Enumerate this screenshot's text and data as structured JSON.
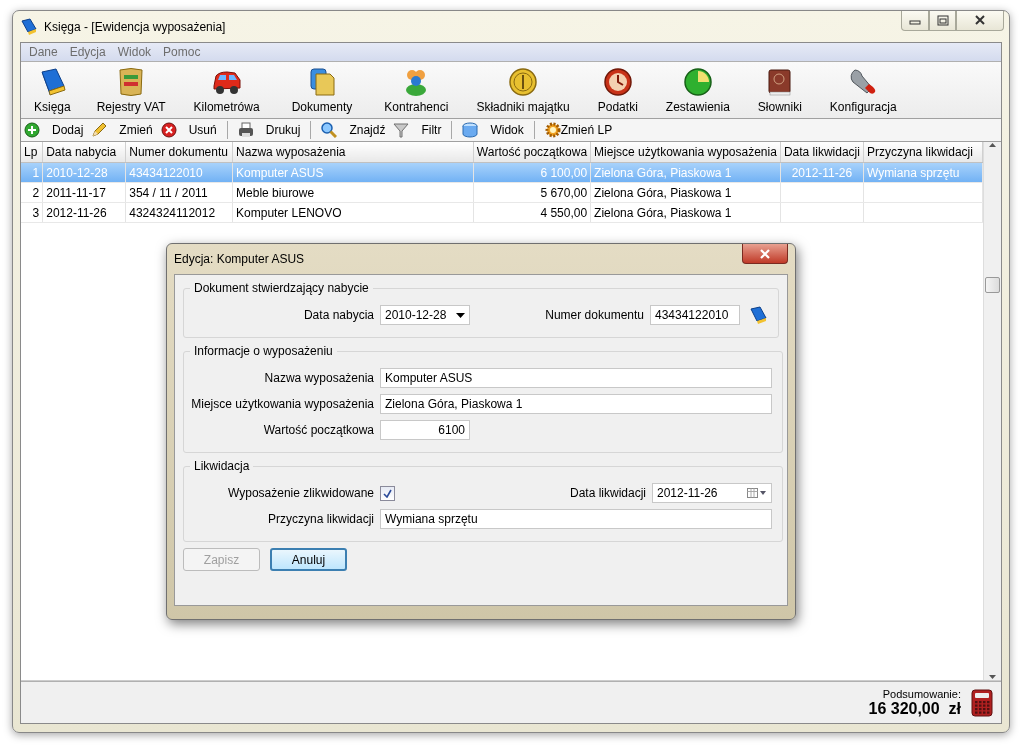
{
  "window": {
    "title": "Księga - [Ewidencja wyposażenia]"
  },
  "menu": [
    {
      "label": "Dane"
    },
    {
      "label": "Edycja"
    },
    {
      "label": "Widok"
    },
    {
      "label": "Pomoc"
    }
  ],
  "modules": [
    {
      "label": "Księga",
      "kind": "book"
    },
    {
      "label": "Rejestry VAT",
      "kind": "vat"
    },
    {
      "label": "Kilometrówa",
      "kind": "car"
    },
    {
      "label": "Dokumenty",
      "kind": "documents"
    },
    {
      "label": "Kontrahenci",
      "kind": "people"
    },
    {
      "label": "Składniki majątku",
      "kind": "coin"
    },
    {
      "label": "Podatki",
      "kind": "clock"
    },
    {
      "label": "Zestawienia",
      "kind": "chart"
    },
    {
      "label": "Słowniki",
      "kind": "dictionary"
    },
    {
      "label": "Konfiguracja",
      "kind": "wrench"
    }
  ],
  "toolbar": [
    {
      "label": "Dodaj",
      "kind": "add",
      "separator_before": false
    },
    {
      "label": "Zmień",
      "kind": "edit",
      "separator_before": false
    },
    {
      "label": "Usuń",
      "kind": "delete",
      "separator_before": false
    },
    {
      "label": "Drukuj",
      "kind": "print",
      "separator_before": true
    },
    {
      "label": "Znajdź",
      "kind": "find",
      "separator_before": true
    },
    {
      "label": "Filtr",
      "kind": "filter",
      "separator_before": false
    },
    {
      "label": "Widok",
      "kind": "view",
      "separator_before": true
    },
    {
      "label": "Zmień LP",
      "kind": "renumber",
      "separator_before": true
    }
  ],
  "table": {
    "columns": [
      {
        "label": "Lp"
      },
      {
        "label": "Data nabycia"
      },
      {
        "label": "Numer dokumentu"
      },
      {
        "label": "Nazwa wyposażenia"
      },
      {
        "label": "Wartość początkowa"
      },
      {
        "label": "Miejsce użytkowania wyposażenia"
      },
      {
        "label": "Data likwidacji"
      },
      {
        "label": "Przyczyna likwidacji"
      }
    ],
    "rows": [
      {
        "selected": true,
        "cells": [
          "1",
          "2010-12-28",
          "43434122010",
          "Komputer ASUS",
          "6 100,00",
          "Zielona Góra, Piaskowa 1",
          "2012-11-26",
          "Wymiana sprzętu"
        ]
      },
      {
        "selected": false,
        "cells": [
          "2",
          "2011-11-17",
          "354 / 11 / 2011",
          "Meble biurowe",
          "5 670,00",
          "Zielona Góra, Piaskowa 1",
          "",
          ""
        ]
      },
      {
        "selected": false,
        "cells": [
          "3",
          "2012-11-26",
          "4324324112012",
          "Komputer LENOVO",
          "4 550,00",
          "Zielona Góra, Piaskowa 1",
          "",
          ""
        ]
      }
    ]
  },
  "status_bar": {
    "label": "Podsumowanie:",
    "total": "16 320,00  zł"
  },
  "dialog": {
    "title": "Edycja: Komputer ASUS",
    "sections": [
      {
        "title": "Dokument stwierdzający nabycie",
        "rows": [
          [
            {
              "label": "Data nabycia",
              "kind": "dropdown",
              "value": "2010-12-28"
            },
            {
              "label": "Numer dokumentu",
              "kind": "lookup",
              "value": "43434122010"
            }
          ]
        ]
      },
      {
        "title": "Informacje o wyposażeniu",
        "rows": [
          [
            {
              "label": "Nazwa wyposażenia",
              "kind": "text",
              "value": "Komputer ASUS"
            }
          ],
          [
            {
              "label": "Miejsce użytkowania wyposażenia",
              "kind": "text",
              "value": "Zielona Góra, Piaskowa 1"
            }
          ],
          [
            {
              "label": "Wartość początkowa",
              "kind": "number",
              "value": "6100"
            }
          ]
        ]
      },
      {
        "title": "Likwidacja",
        "rows": [
          [
            {
              "label": "Wyposażenie zlikwidowane",
              "kind": "checkbox",
              "checked": true
            },
            {
              "label": "Data likwidacji",
              "kind": "datepicker",
              "value": "2012-11-26"
            }
          ],
          [
            {
              "label": "Przyczyna likwidacji",
              "kind": "text",
              "value": "Wymiana sprzętu"
            }
          ]
        ]
      }
    ],
    "buttons": [
      {
        "label": "Zapisz",
        "disabled": true,
        "default": false
      },
      {
        "label": "Anuluj",
        "disabled": false,
        "default": true
      }
    ]
  }
}
